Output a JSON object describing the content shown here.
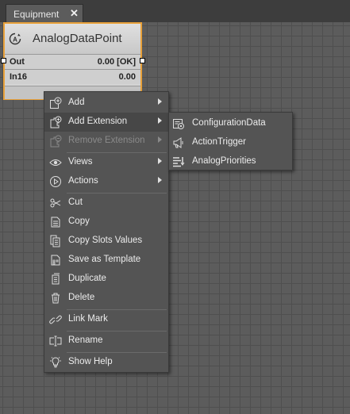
{
  "tab": {
    "label": "Equipment",
    "close": "✕"
  },
  "node": {
    "title": "AnalogDataPoint",
    "rows": [
      {
        "name": "Out",
        "value": "0.00 [OK]"
      },
      {
        "name": "In16",
        "value": "0.00"
      }
    ]
  },
  "context_menu": {
    "items": [
      {
        "label": "Add"
      },
      {
        "label": "Add Extension"
      },
      {
        "label": "Remove Extension"
      },
      {
        "label": "Views"
      },
      {
        "label": "Actions"
      },
      {
        "label": "Cut"
      },
      {
        "label": "Copy"
      },
      {
        "label": "Copy Slots Values"
      },
      {
        "label": "Save as Template"
      },
      {
        "label": "Duplicate"
      },
      {
        "label": "Delete"
      },
      {
        "label": "Link Mark"
      },
      {
        "label": "Rename"
      },
      {
        "label": "Show Help"
      }
    ]
  },
  "submenu": {
    "items": [
      {
        "label": "ConfigurationData"
      },
      {
        "label": "ActionTrigger"
      },
      {
        "label": "AnalogPriorities"
      }
    ]
  },
  "colors": {
    "accent": "#e8a13a",
    "background": "#5c5c5c",
    "menu": "#545454"
  }
}
